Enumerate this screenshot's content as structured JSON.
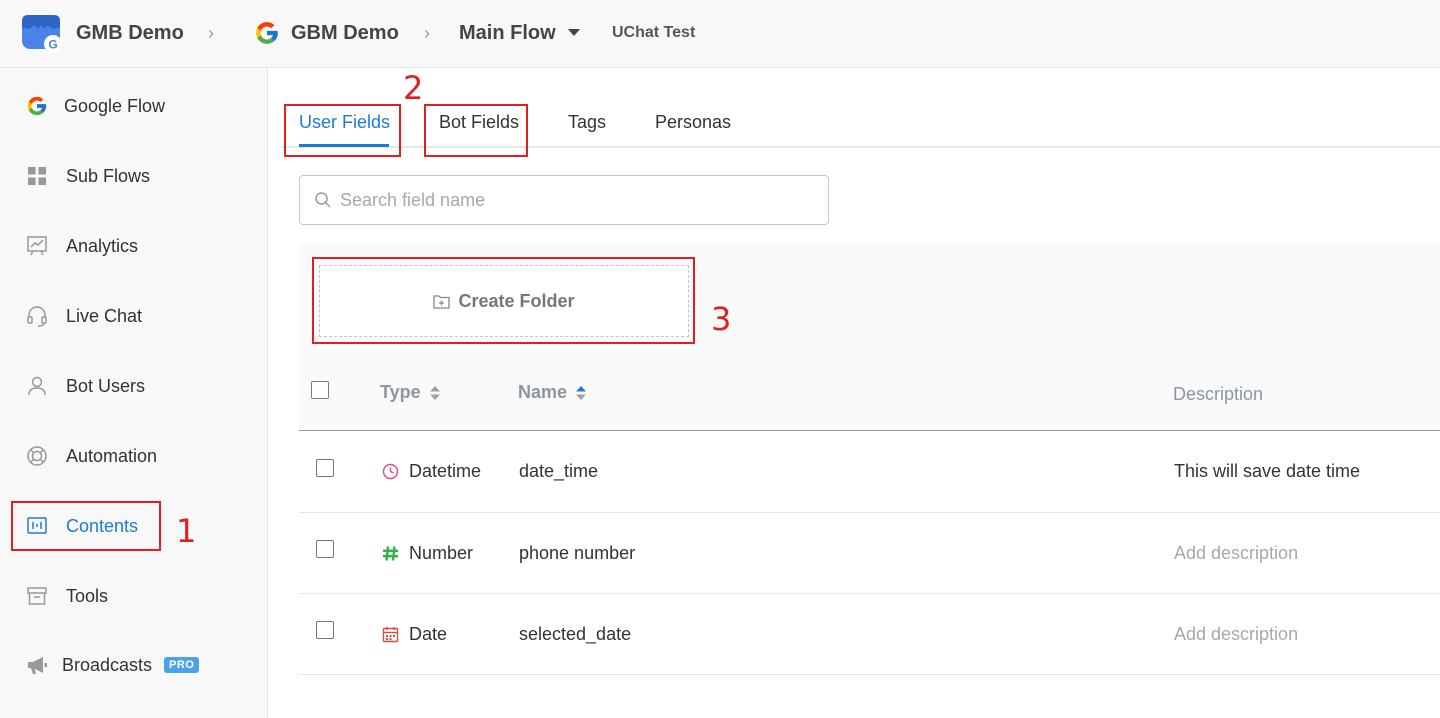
{
  "breadcrumb": {
    "workspace": "GMB Demo",
    "channel": "GBM Demo",
    "flow": "Main Flow",
    "bot": "UChat Test"
  },
  "sidebar": {
    "items": [
      {
        "label": "Google Flow",
        "icon": "google-icon"
      },
      {
        "label": "Sub Flows",
        "icon": "grid-icon"
      },
      {
        "label": "Analytics",
        "icon": "chart-icon"
      },
      {
        "label": "Live Chat",
        "icon": "headset-icon"
      },
      {
        "label": "Bot Users",
        "icon": "user-icon"
      },
      {
        "label": "Automation",
        "icon": "lifebuoy-icon"
      },
      {
        "label": "Contents",
        "icon": "contents-icon"
      },
      {
        "label": "Tools",
        "icon": "archive-icon"
      },
      {
        "label": "Broadcasts",
        "icon": "megaphone-icon",
        "badge": "PRO"
      }
    ]
  },
  "tabs": [
    {
      "label": "User Fields",
      "active": true
    },
    {
      "label": "Bot Fields"
    },
    {
      "label": "Tags"
    },
    {
      "label": "Personas"
    }
  ],
  "search": {
    "placeholder": "Search field name"
  },
  "create_folder": {
    "label": "Create Folder"
  },
  "table": {
    "columns": {
      "type": "Type",
      "name": "Name",
      "description": "Description"
    },
    "rows": [
      {
        "type": "Datetime",
        "type_icon": "clock-icon",
        "name": "date_time",
        "description": "This will save date time",
        "has_description": true
      },
      {
        "type": "Number",
        "type_icon": "hash-icon",
        "name": "phone number",
        "description": "Add description",
        "has_description": false
      },
      {
        "type": "Date",
        "type_icon": "calendar-icon",
        "name": "selected_date",
        "description": "Add description",
        "has_description": false
      }
    ]
  },
  "annotations": {
    "one": "1",
    "two": "2",
    "three": "3"
  },
  "colors": {
    "accent": "#1d7bd4",
    "annotation": "#e02020",
    "number_icon": "#2fb344",
    "datetime_icon": "#d94a8c",
    "date_icon": "#e04b3a"
  }
}
